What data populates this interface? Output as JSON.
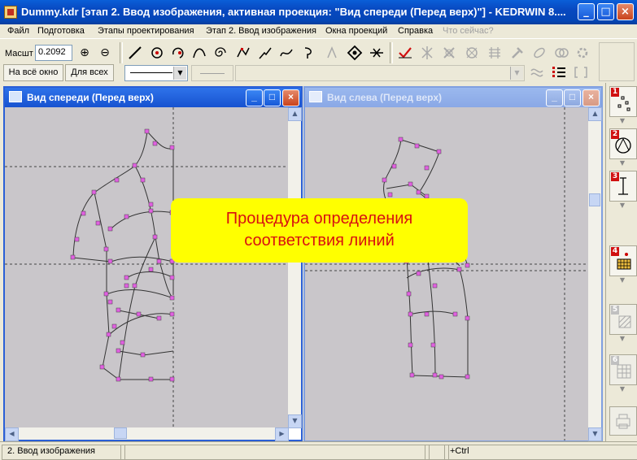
{
  "window": {
    "title": "Dummy.kdr [этап 2. Ввод изображения, активная проекция: \"Вид спереди (Перед верх)\"] - KEDRWIN 8....",
    "min": "_",
    "max": "□",
    "close": "×"
  },
  "menu": {
    "items": [
      "Файл",
      "Подготовка",
      "Этапы проектирования",
      "Этап 2. Ввод изображения",
      "Окна проекций",
      "Справка"
    ],
    "disabled_item": "Что сейчас?"
  },
  "toolbar": {
    "scale_label": "Масшт",
    "scale_value": "0.2092",
    "fit_window_label": "На всё окно",
    "for_all_label": "Для всех",
    "zoom_in_icon": "⊕",
    "zoom_out_icon": "⊖"
  },
  "front_view": {
    "title": "Вид спереди (Перед верх)"
  },
  "left_view": {
    "title": "Вид слева (Перед верх)"
  },
  "banner": {
    "line1": "Процедура определения",
    "line2": "соответствия линий"
  },
  "steps": [
    {
      "num": "1",
      "enabled": true
    },
    {
      "num": "2",
      "enabled": true
    },
    {
      "num": "3",
      "enabled": true
    },
    {
      "num": "4",
      "enabled": true
    },
    {
      "num": "5",
      "enabled": false
    },
    {
      "num": "6",
      "enabled": false
    }
  ],
  "status": {
    "stage": "2. Ввод изображения",
    "modifier": "+Ctrl"
  },
  "colors": {
    "point_fill": "#e060e0",
    "banner_bg": "#ffff00",
    "banner_text": "#d81010"
  }
}
